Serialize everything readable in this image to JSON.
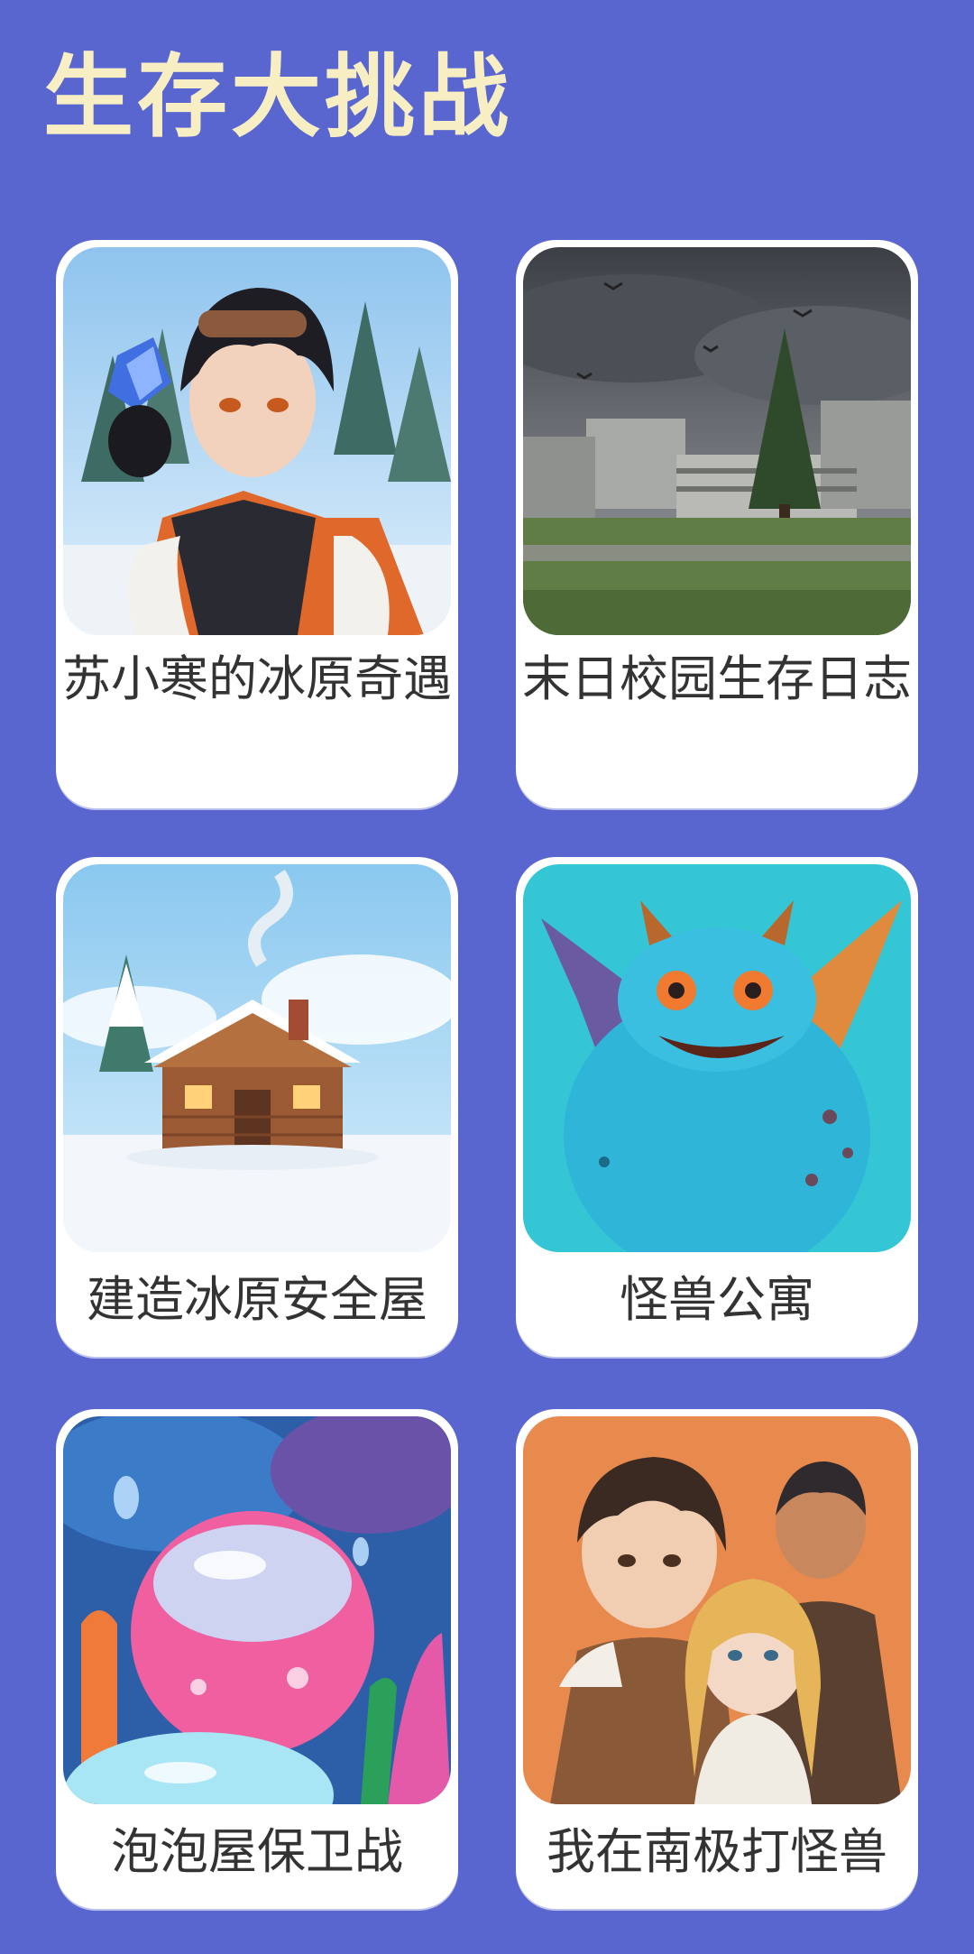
{
  "header": {
    "title": "生存大挑战"
  },
  "cards": [
    {
      "title": "苏小寒的冰原奇遇",
      "image": "anime-boy-snow-forest-crystal"
    },
    {
      "title": "末日校园生存日志",
      "image": "ruined-school-stormy-sky"
    },
    {
      "title": "建造冰原安全屋",
      "image": "snow-log-cabin"
    },
    {
      "title": "怪兽公寓",
      "image": "blue-winged-monster"
    },
    {
      "title": "泡泡屋保卫战",
      "image": "underwater-bubbles-coral"
    },
    {
      "title": "我在南极打怪兽",
      "image": "anime-trio-orange-background"
    }
  ]
}
